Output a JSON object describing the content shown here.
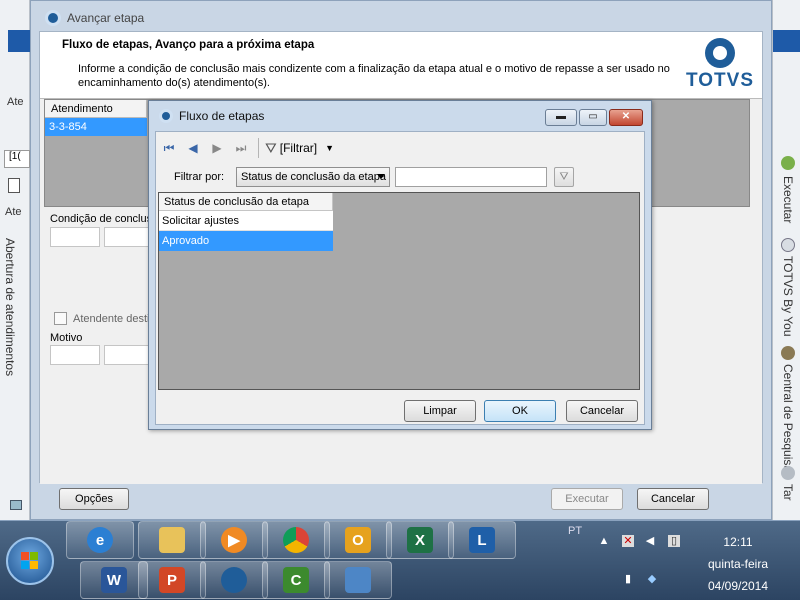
{
  "background": {
    "left_label": "Ate",
    "left_label2": "Ate",
    "left_tab": "[1(",
    "left_vertical": "Abertura de atendimentos",
    "right_items": [
      "Executar",
      "TOTVS By You",
      "Central de Pesquisa",
      "Tar"
    ]
  },
  "main_dialog": {
    "title": "Avançar etapa",
    "header_title": "Fluxo de etapas, Avanço para a próxima etapa",
    "header_desc": "Informe a condição de conclusão mais condizente com a finalização da etapa atual e o motivo de repasse a ser usado no encaminhamento do(s) atendimento(s).",
    "logo_text": "TOTVS",
    "grid_header": "Atendimento",
    "grid_row": "3-3-854",
    "condition_label": "Condição de conclusã",
    "checkbox_label": "Atendente destir",
    "motive_label": "Motivo",
    "options_button": "Opções",
    "execute_button": "Executar",
    "cancel_button": "Cancelar"
  },
  "modal": {
    "title": "Fluxo de etapas",
    "filter_button": "[Filtrar]",
    "filter_by_label": "Filtrar por:",
    "filter_field": "Status de conclusão da etapa",
    "filter_value": "",
    "grid_header": "Status de conclusão da etapa",
    "rows": [
      "Solicitar ajustes",
      "Aprovado"
    ],
    "selected_row": "Aprovado",
    "clear_button": "Limpar",
    "ok_button": "OK",
    "cancel_button": "Cancelar"
  },
  "taskbar": {
    "language": "PT",
    "time": "12:11",
    "day": "quinta-feira",
    "date": "04/09/2014"
  },
  "colors": {
    "selection": "#3399ff",
    "totvs_blue": "#1f5d99",
    "taskbar": "#2c4462"
  }
}
